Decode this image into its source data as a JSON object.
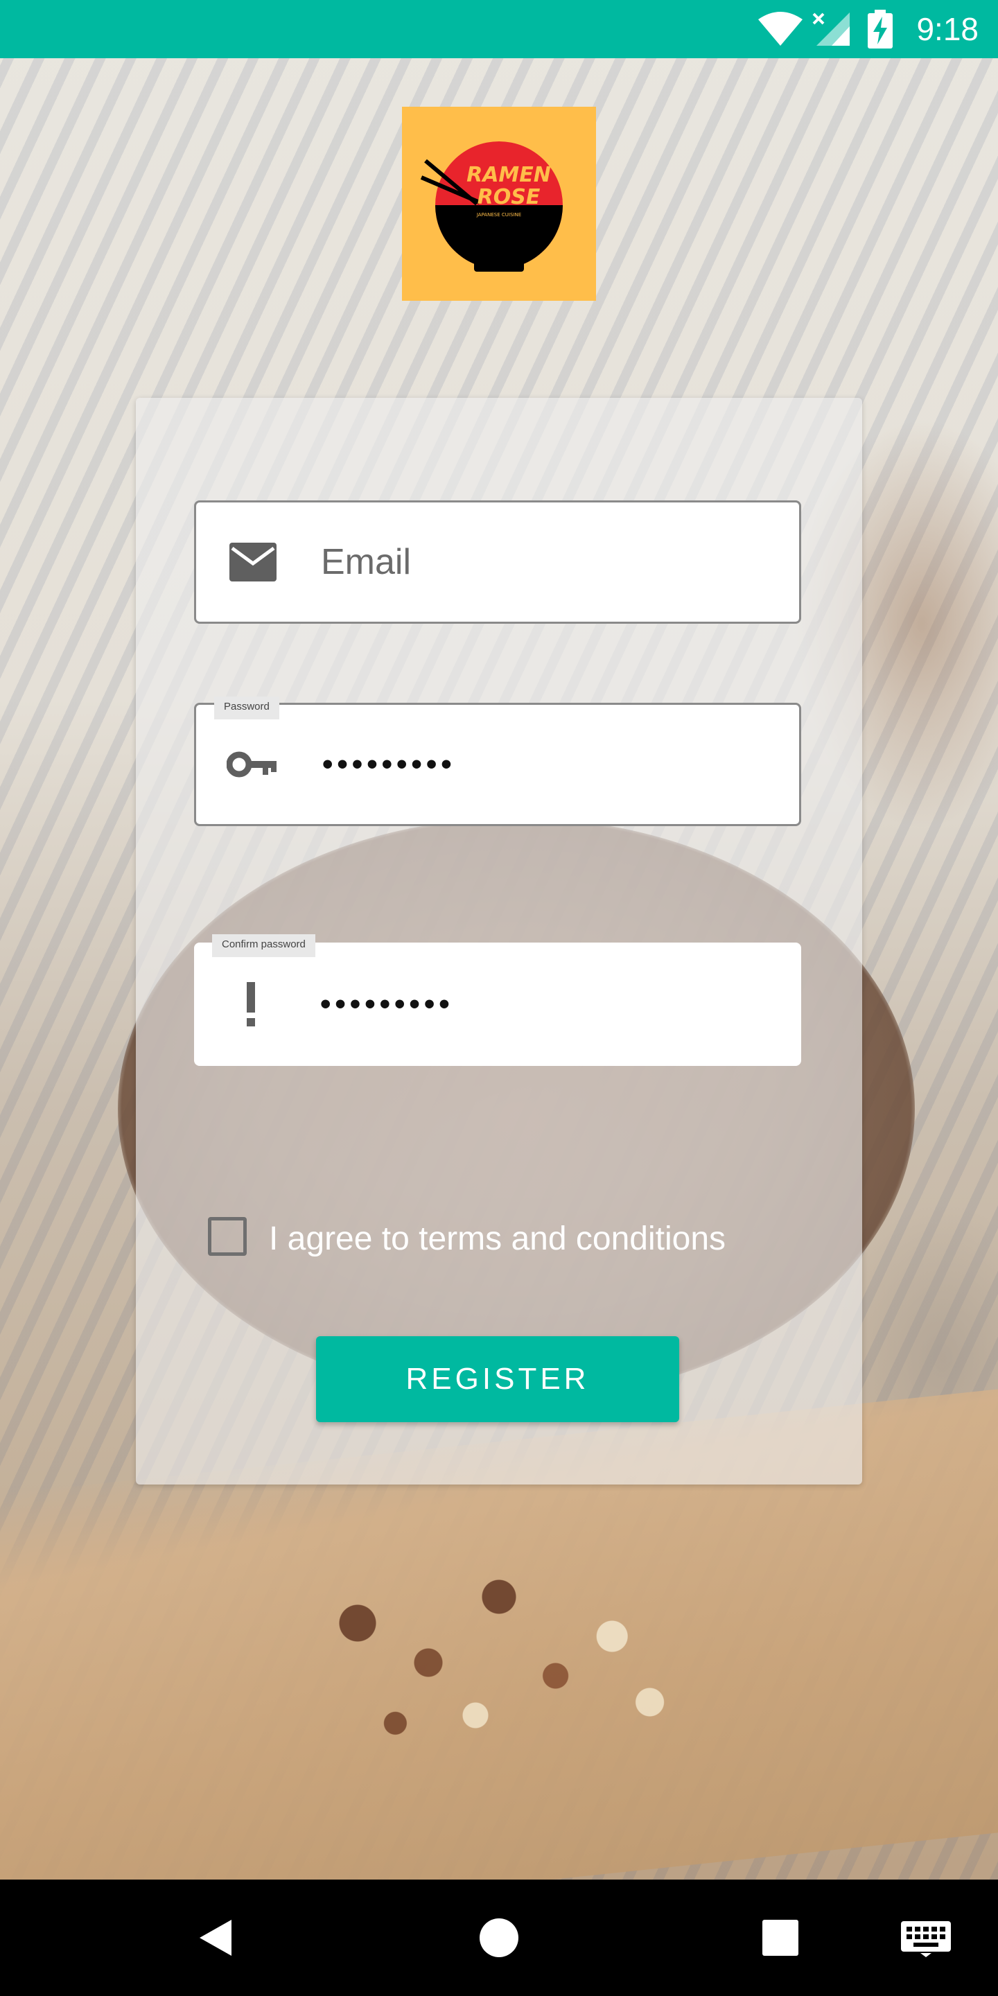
{
  "status_bar": {
    "time": "9:18",
    "background": "#00b9a0",
    "icons": [
      "wifi-icon",
      "signal-icon",
      "battery-charging-icon"
    ]
  },
  "logo": {
    "line1": "RAMEN",
    "line2": "ROSE",
    "tagline": "JAPANESE CUISINE",
    "background": "#ffbe4a"
  },
  "form": {
    "email": {
      "placeholder": "Email",
      "icon": "mail-icon"
    },
    "password": {
      "label": "Password",
      "value": "•••••••••",
      "icon": "key-icon"
    },
    "confirm_password": {
      "label": "Confirm password",
      "value": "•••••••••",
      "icon": "exclamation-icon"
    },
    "terms": {
      "label": "I agree to terms and conditions",
      "checked": false
    },
    "register_label": "REGISTER"
  },
  "colors": {
    "accent": "#00b9a0"
  },
  "nav_bar": {
    "icons": [
      "back-icon",
      "home-icon",
      "recents-icon",
      "keyboard-icon"
    ]
  }
}
